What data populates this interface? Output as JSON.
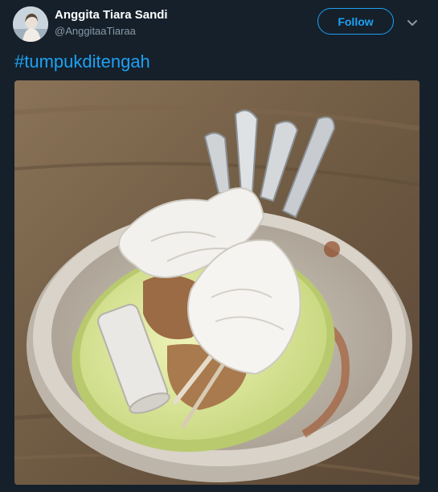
{
  "tweet": {
    "display_name": "Anggita Tiara Sandi",
    "handle": "@AnggitaaTiaraa",
    "follow_label": "Follow",
    "hashtag": "#tumpukditengah"
  },
  "icons": {
    "more": "chevron-down-icon"
  },
  "colors": {
    "background": "#15202b",
    "accent": "#1da1f2",
    "secondary_text": "#8899a6"
  }
}
